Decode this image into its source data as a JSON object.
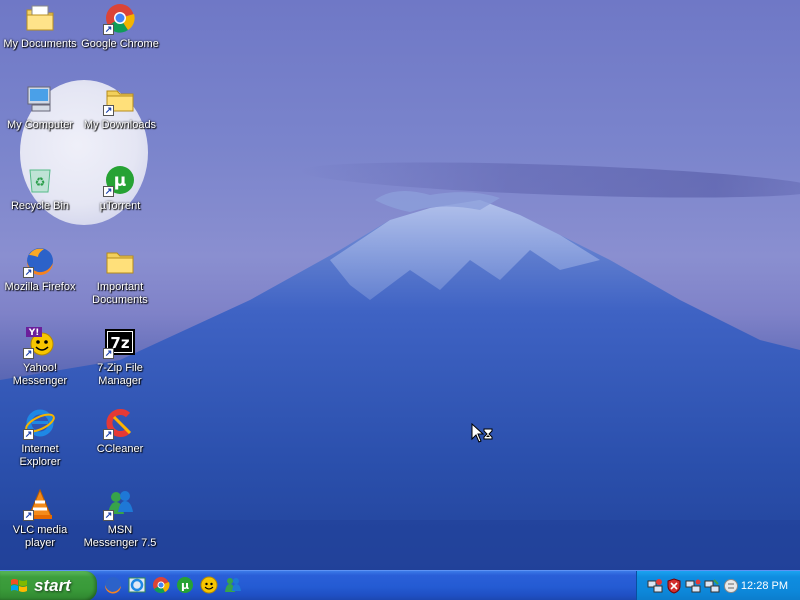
{
  "desktop": {
    "icons": [
      {
        "label": "My Documents",
        "icon": "my-documents-icon",
        "shortcut": false
      },
      {
        "label": "Google Chrome",
        "icon": "chrome-icon",
        "shortcut": true
      },
      {
        "label": "My Computer",
        "icon": "my-computer-icon",
        "shortcut": false
      },
      {
        "label": "My Downloads",
        "icon": "folder-icon",
        "shortcut": true
      },
      {
        "label": "Recycle Bin",
        "icon": "recycle-bin-icon",
        "shortcut": false
      },
      {
        "label": "µTorrent",
        "icon": "utorrent-icon",
        "shortcut": true
      },
      {
        "label": "Mozilla Firefox",
        "icon": "firefox-icon",
        "shortcut": true
      },
      {
        "label": "Important Documents",
        "icon": "folder-icon",
        "shortcut": false
      },
      {
        "label": "Yahoo! Messenger",
        "icon": "yahoo-messenger-icon",
        "shortcut": true
      },
      {
        "label": "7-Zip File Manager",
        "icon": "seven-zip-icon",
        "shortcut": true
      },
      {
        "label": "Internet Explorer",
        "icon": "internet-explorer-icon",
        "shortcut": true
      },
      {
        "label": "CCleaner",
        "icon": "ccleaner-icon",
        "shortcut": true
      },
      {
        "label": "VLC media player",
        "icon": "vlc-icon",
        "shortcut": true
      },
      {
        "label": "MSN Messenger 7.5",
        "icon": "msn-messenger-icon",
        "shortcut": true
      }
    ]
  },
  "taskbar": {
    "start_label": "start",
    "quick_launch": [
      "firefox-icon",
      "internet-explorer-icon",
      "chrome-icon",
      "utorrent-icon",
      "yahoo-messenger-icon",
      "msn-messenger-icon"
    ],
    "tray_icons": [
      "network-icon",
      "security-shield-icon",
      "network-icon",
      "network-icon",
      "messenger-icon"
    ],
    "clock": "12:28 PM"
  },
  "colors": {
    "taskbar_blue": "#245bd3",
    "start_green": "#3d9e3d",
    "tray_blue": "#0f8de0"
  }
}
